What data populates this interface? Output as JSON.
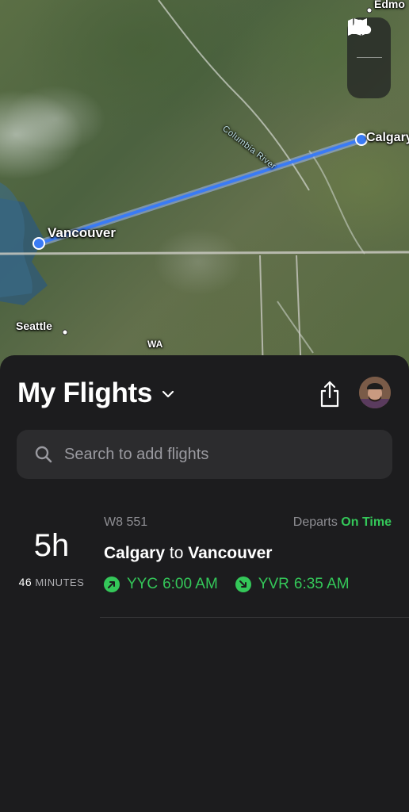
{
  "map": {
    "labels": {
      "vancouver": "Vancouver",
      "calgary": "Calgary",
      "seattle": "Seattle",
      "edmonton": "Edmo",
      "wa": "WA",
      "river": "Columbia River"
    },
    "controls": {
      "map_icon": "map-icon",
      "weather_icon": "cloud-icon"
    },
    "route_color": "#3a7bf5"
  },
  "header": {
    "title": "My Flights",
    "share_icon": "share-icon",
    "chevron_icon": "chevron-down-icon"
  },
  "search": {
    "placeholder": "Search to add flights"
  },
  "flight": {
    "duration_hours": "5h",
    "duration_minutes_value": "46",
    "duration_minutes_unit": "MINUTES",
    "number": "W8 551",
    "status_prefix": "Departs",
    "status": "On Time",
    "origin_city": "Calgary",
    "connector": "to",
    "destination_city": "Vancouver",
    "origin_code": "YYC",
    "departure_time": "6:00 AM",
    "destination_code": "YVR",
    "arrival_time": "6:35 AM"
  },
  "colors": {
    "accent_green": "#34c759",
    "background": "#1c1c1e",
    "search_bg": "#2c2c2e"
  }
}
